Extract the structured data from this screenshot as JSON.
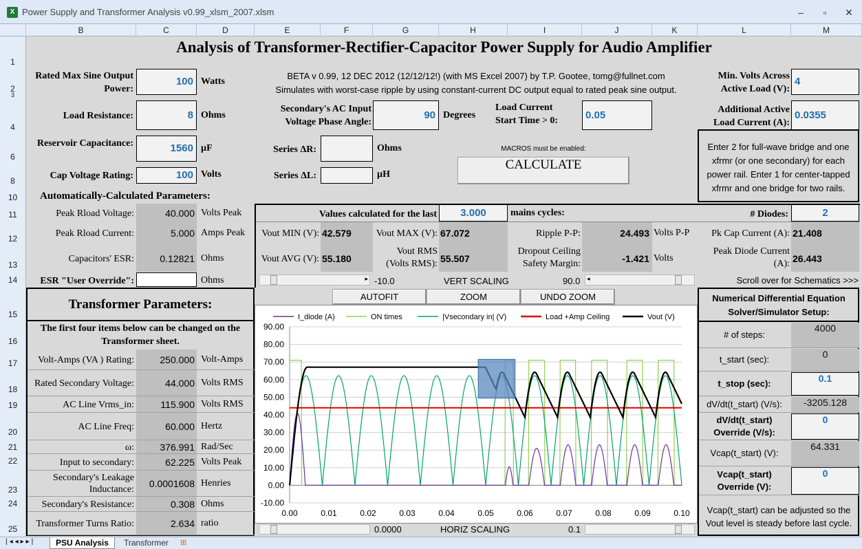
{
  "window": {
    "title": "Power Supply and Transformer Analysis v0.99_xlsm_2007.xlsm",
    "minimize": "–",
    "restore": "▫",
    "close": "✕"
  },
  "columns": [
    "B",
    "C",
    "D",
    "E",
    "F",
    "G",
    "H",
    "I",
    "J",
    "K",
    "L",
    "M"
  ],
  "rows": [
    "1",
    "2",
    "3",
    "4",
    "6",
    "8",
    "10",
    "11",
    "12",
    "13",
    "14",
    "15",
    "16",
    "17",
    "18",
    "19",
    "20",
    "21",
    "22",
    "23",
    "24",
    "25"
  ],
  "sheet_title": "Analysis of Transformer-Rectifier-Capacitor Power Supply for Audio Amplifier",
  "inputs": {
    "rated_power_label": "Rated Max Sine Output Power:",
    "rated_power": "100",
    "rated_power_unit": "Watts",
    "load_res_label": "Load Resistance:",
    "load_res": "8",
    "load_res_unit": "Ohms",
    "reservoir_label": "Reservoir Capacitance:",
    "reservoir": "1560",
    "reservoir_unit": "µF",
    "cap_v_label": "Cap Voltage Rating:",
    "cap_v": "100",
    "cap_v_unit": "Volts",
    "phase_label": "Secondary's AC Input Voltage  Phase Angle:",
    "phase": "90",
    "phase_unit": "Degrees",
    "lc_start_label": "Load Current Start Time > 0:",
    "lc_start": "0.05",
    "series_r_label": "Series ΔR:",
    "series_r": "",
    "series_r_unit": "Ohms",
    "series_l_label": "Series ΔL:",
    "series_l": "",
    "series_l_unit": "µH",
    "min_volts_label": "Min. Volts Across Active Load (V):",
    "min_volts": "4",
    "add_current_label": "Additional Active Load Current  (A):",
    "add_current": "0.0355"
  },
  "info_line1": "BETA v 0.99, 12 DEC 2012 (12/12/12!) (with MS Excel 2007) by T.P. Gootee, tomg@fullnet.com",
  "info_line2": "Simulates with worst-case ripple by using constant-current DC output equal to rated peak sine output.",
  "macros_note": "MACROS must be enabled:",
  "calculate_label": "CALCULATE",
  "diodes_note": "Enter 2 for full-wave bridge and one xfrmr (or one secondary) for each power rail. Enter 1 for center-tapped xfrmr and one bridge for two rails.",
  "auto_header": "Automatically-Calculated Parameters:",
  "auto": [
    {
      "label": "Peak Rload Voltage:",
      "value": "40.000",
      "unit": "Volts Peak"
    },
    {
      "label": "Peak Rload Current:",
      "value": "5.000",
      "unit": "Amps Peak"
    },
    {
      "label": "Capacitors' ESR:",
      "value": "0.12821",
      "unit": "Ohms"
    }
  ],
  "esr_override_label": "ESR \"User Override\":",
  "esr_override_unit": "Ohms",
  "values_header": "Values calculated for the last",
  "cycles": "3.000",
  "cycles_unit": "mains cycles:",
  "diodes_label": "# Diodes:",
  "diodes": "2",
  "results": {
    "vout_min_label": "Vout MIN (V):",
    "vout_min": "42.579",
    "vout_max_label": "Vout MAX (V):",
    "vout_max": "67.072",
    "ripple_label": "Ripple P-P:",
    "ripple": "24.493",
    "ripple_unit": "Volts P-P",
    "pk_cap_label": "Pk Cap Current (A):",
    "pk_cap": "21.408",
    "vout_avg_label": "Vout AVG (V):",
    "vout_avg": "55.180",
    "vout_rms_label": "Vout RMS (Volts RMS):",
    "vout_rms": "55.507",
    "dropout_label": "Dropout Ceiling Safety Margin:",
    "dropout": "-1.421",
    "dropout_unit": "Volts",
    "pk_diode_label": "Peak Diode Current (A):",
    "pk_diode": "26.443"
  },
  "vert_scroll": {
    "min": "-10.0",
    "label": "VERT SCALING",
    "max": "90.0"
  },
  "horiz_scroll": {
    "min": "0.0000",
    "label": "HORIZ SCALING",
    "max": "0.1"
  },
  "scroll_note": "Scroll over for Schematics >>>",
  "chart_buttons": [
    "AUTOFIT",
    "ZOOM",
    "UNDO ZOOM"
  ],
  "transformer": {
    "header": "Transformer Parameters:",
    "note": "The first four items below can be changed  on the Transformer sheet.",
    "rows": [
      {
        "label": "Volt-Amps (VA ) Rating:",
        "value": "250.000",
        "unit": "Volt-Amps"
      },
      {
        "label": "Rated Secondary Voltage:",
        "value": "44.000",
        "unit": "Volts RMS"
      },
      {
        "label": "AC Line Vrms_in:",
        "value": "115.900",
        "unit": "Volts RMS"
      },
      {
        "label": "AC Line Freq:",
        "value": "60.000",
        "unit": "Hertz"
      },
      {
        "label": "ω:",
        "value": "376.991",
        "unit": "Rad/Sec"
      },
      {
        "label": "Input to secondary:",
        "value": "62.225",
        "unit": "Volts Peak"
      },
      {
        "label": "Secondary's Leakage Inductance:",
        "value": "0.0001608",
        "unit": "Henries"
      },
      {
        "label": "Secondary's Resistance:",
        "value": "0.308",
        "unit": "Ohms"
      },
      {
        "label": "Transformer Turns Ratio:",
        "value": "2.634",
        "unit": "ratio"
      }
    ]
  },
  "solver": {
    "header": "Numerical Differential Equation Solver/Simulator Setup:",
    "rows": [
      {
        "label": "# of steps:",
        "value": "4000",
        "input": false
      },
      {
        "label": "t_start (sec):",
        "value": "0",
        "input": false
      },
      {
        "label": "t_stop (sec):",
        "value": "0.1",
        "input": true
      },
      {
        "label": "dV/dt(t_start) (V/s):",
        "value": "-3205.128",
        "input": false
      },
      {
        "label": "dV/dt(t_start) Override (V/s):",
        "value": "0",
        "input": true
      },
      {
        "label": "Vcap(t_start) (V):",
        "value": "64.331",
        "input": false
      },
      {
        "label": "Vcap(t_start) Override (V):",
        "value": "0",
        "input": true
      }
    ],
    "note": "Vcap(t_start) can be adjusted so the Vout level is steady before last cycle."
  },
  "tabs": [
    "PSU Analysis",
    "Transformer"
  ],
  "chart_data": {
    "type": "line",
    "xlim": [
      0.0,
      0.1
    ],
    "ylim": [
      -10,
      90
    ],
    "x_ticks": [
      "0.00",
      "0.01",
      "0.02",
      "0.03",
      "0.04",
      "0.05",
      "0.06",
      "0.07",
      "0.08",
      "0.09",
      "0.10"
    ],
    "y_ticks": [
      "90.00",
      "80.00",
      "70.00",
      "60.00",
      "50.00",
      "40.00",
      "30.00",
      "20.00",
      "10.00",
      "0.00",
      "-10.00"
    ],
    "grid": "horizontal",
    "legend_position": "top",
    "series": [
      {
        "name": "I_diode (A)",
        "color": "#7030a0"
      },
      {
        "name": "ON times",
        "color": "#92d050"
      },
      {
        "name": "|Vsecondary in|  (V)",
        "color": "#00a36c"
      },
      {
        "name": "Load +Amp Ceiling",
        "color": "#e00000"
      },
      {
        "name": "Vout (V)",
        "color": "#000000"
      }
    ],
    "params": {
      "freq_hz": 60,
      "vsec_peak": 62.225,
      "ceiling": 44,
      "vout_plateau": 67.072,
      "vout_min": 42.579,
      "load_start": 0.05,
      "on_level": 71,
      "diode_startup_peak": 41,
      "diode_peaks": [
        10.5,
        21,
        23,
        23,
        23,
        23
      ]
    }
  }
}
